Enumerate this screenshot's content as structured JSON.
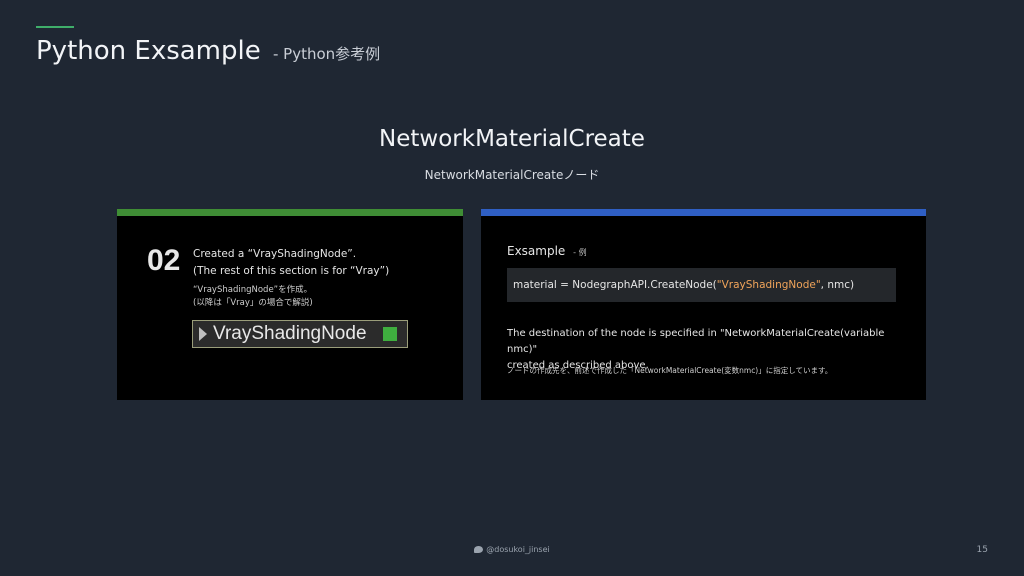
{
  "slide": {
    "title": "Python Exsample",
    "title_sub": "- Python参考例",
    "heading": "NetworkMaterialCreate",
    "subheading": "NetworkMaterialCreateノード"
  },
  "left_card": {
    "step_number": "02",
    "line1": "Created a “VrayShadingNode”.",
    "line2": "(The rest of this section is for “Vray”)",
    "jp1": "“VrayShadingNode”を作成。",
    "jp2": "(以降は「Vray」の場合で解説)",
    "node_label": "VrayShadingNode"
  },
  "right_card": {
    "title": "Exsample",
    "title_sub": "- 例",
    "code_prefix": "material = NodegraphAPI.CreateNode(",
    "code_string": "\"VrayShadingNode\"",
    "code_suffix": ", nmc)",
    "desc1": "The destination of the node is specified in \"NetworkMaterialCreate(variable nmc)\"",
    "desc2": "created as described above.",
    "desc_jp": "ノードの作成先を、前述で作成した「NetworkMaterialCreate(変数nmc)」に指定しています。"
  },
  "footer": {
    "handle": "@dosukoi_jinsei",
    "page": "15"
  },
  "colors": {
    "background": "#1f2733",
    "accent_green": "#3f8d35",
    "accent_blue": "#2f5fc4",
    "code_string": "#f0a45a"
  },
  "icons": [
    "twitter-bird-icon",
    "play-arrow-icon"
  ]
}
